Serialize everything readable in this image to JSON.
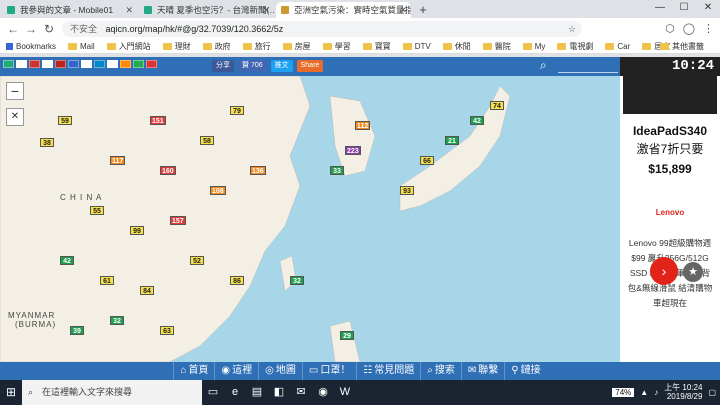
{
  "tabs": [
    {
      "label": "我參與的文章 - Mobile01",
      "active": false
    },
    {
      "label": "天晴 夏季也空污？- 台灣新聞(…",
      "active": false
    },
    {
      "label": "亞洲空氣污染：實時空氣質量指數",
      "active": true
    }
  ],
  "window_controls": {
    "minimize": "—",
    "maximize": "☐",
    "close": "✕"
  },
  "address": {
    "insecure_label": "不安全",
    "url": "aqicn.org/map/hk/#@g/32.7039/120.3662/5z"
  },
  "bookmarks": [
    "Bookmarks",
    "Mail",
    "入門網站",
    "理財",
    "政府",
    "旅行",
    "房屋",
    "學習",
    "寶寶",
    "DTV",
    "休閒",
    "醫院",
    "My",
    "電視劇",
    "Car",
    "居家"
  ],
  "bookmarks_right": "其他書籤",
  "aqi_bar": {
    "flags": [
      "#2a7",
      "#fff",
      "#c33",
      "#fff",
      "#b22",
      "#36c",
      "#fff",
      "#08c",
      "#fff",
      "#f80",
      "#2a5",
      "#d33"
    ],
    "share_label": "分享",
    "like_label": "贊 706",
    "tweet_label": "推文",
    "share2_label": "Share",
    "clock": "10:24"
  },
  "map_labels": {
    "china": "C H I N A",
    "myanmar": "MYANMAR",
    "burma": "(BURMA)"
  },
  "map_markers": [
    {
      "v": "38",
      "c": "#f7e14a"
    },
    {
      "v": "59",
      "c": "#f7e14a"
    },
    {
      "v": "117",
      "c": "#f28a22"
    },
    {
      "v": "151",
      "c": "#e03a3a"
    },
    {
      "v": "160",
      "c": "#e03a3a"
    },
    {
      "v": "58",
      "c": "#f7e14a"
    },
    {
      "v": "79",
      "c": "#f7e14a"
    },
    {
      "v": "55",
      "c": "#f7e14a"
    },
    {
      "v": "99",
      "c": "#f7e14a"
    },
    {
      "v": "157",
      "c": "#e03a3a"
    },
    {
      "v": "108",
      "c": "#f28a22"
    },
    {
      "v": "136",
      "c": "#f28a22"
    },
    {
      "v": "42",
      "c": "#1f9e4e"
    },
    {
      "v": "61",
      "c": "#f7e14a"
    },
    {
      "v": "84",
      "c": "#f7e14a"
    },
    {
      "v": "223",
      "c": "#8b3fa8"
    },
    {
      "v": "112",
      "c": "#f28a22"
    },
    {
      "v": "33",
      "c": "#1f9e4e"
    },
    {
      "v": "66",
      "c": "#f7e14a"
    },
    {
      "v": "21",
      "c": "#1f9e4e"
    },
    {
      "v": "42",
      "c": "#1f9e4e"
    },
    {
      "v": "74",
      "c": "#f7e14a"
    },
    {
      "v": "93",
      "c": "#f7e14a"
    },
    {
      "v": "32",
      "c": "#1f9e4e"
    },
    {
      "v": "29",
      "c": "#1f9e4e"
    },
    {
      "v": "52",
      "c": "#f7e14a"
    },
    {
      "v": "86",
      "c": "#f7e14a"
    },
    {
      "v": "39",
      "c": "#1f9e4e"
    },
    {
      "v": "32",
      "c": "#1f9e4e"
    },
    {
      "v": "63",
      "c": "#f7e14a"
    }
  ],
  "ad": {
    "title": "IdeaPadS340",
    "subtitle": "激省7折只要",
    "price": "$15,899",
    "brand": "Lenovo",
    "desc": "Lenovo 99超級購物週 $99 贏升256G/512G SSD $9加購筆電後背包&無線滑鼠 結清購物車超現在",
    "go": "›",
    "fav": "★"
  },
  "bottom_nav": [
    {
      "icon": "⌂",
      "label": "首頁"
    },
    {
      "icon": "◉",
      "label": "這裡"
    },
    {
      "icon": "◎",
      "label": "地圖"
    },
    {
      "icon": "▭",
      "label": "口罩！"
    },
    {
      "icon": "☷",
      "label": "常見問題"
    },
    {
      "icon": "⌕",
      "label": "搜索"
    },
    {
      "icon": "✉",
      "label": "聯繫"
    },
    {
      "icon": "⚲",
      "label": "鏈接"
    }
  ],
  "taskbar": {
    "search_placeholder": "在這裡輸入文字來搜尋",
    "battery": "74%",
    "time": "上午 10:24",
    "date": "2019/8/29"
  }
}
